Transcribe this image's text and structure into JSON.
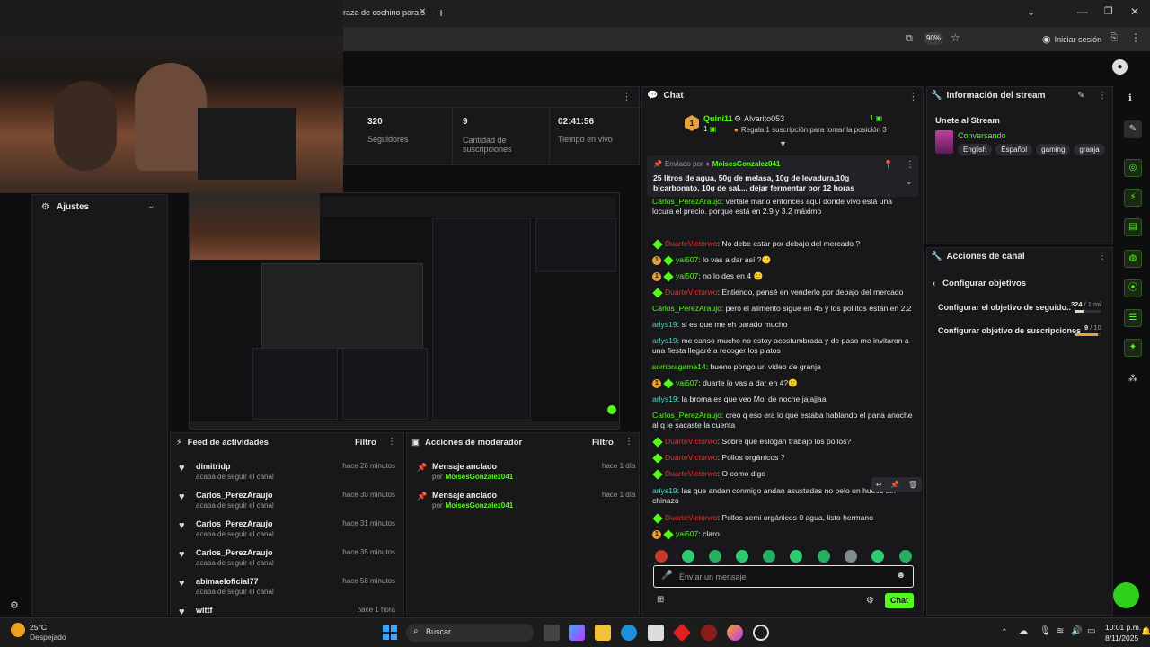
{
  "browser": {
    "tab_title": "raza de cochino para s",
    "zoom": "90%",
    "signin_label": "Iniciar sesión"
  },
  "stats": {
    "followers_value": "320",
    "followers_label": "Seguidores",
    "subs_value": "9",
    "subs_label_1": "Cantidad de",
    "subs_label_2": "suscripciones",
    "live_value": "02:41:56",
    "live_label": "Tiempo en vivo"
  },
  "settings_label": "Ajustes",
  "chat": {
    "title": "Chat",
    "top1_name": "Quini11",
    "top1_count": "1",
    "top2_name": "Alvarito053",
    "top2_count": "1",
    "gift_text": "Regala 1 suscripción para tomar la posición 3",
    "pinned_by_label": "Enviado por",
    "pinned_by_user": "MoisesGonzalez041",
    "pinned_text": "25 litros de agua, 50g de melasa, 10g de levadura,10g bicarbonato, 10g de sal.... dejar fermentar por 12 horas",
    "input_placeholder": "Enviar un mensaje",
    "send_label": "Chat",
    "messages": [
      {
        "user": "Carlos_PerezAraujo",
        "text": ": vertale mano entonces aquí donde vivo está una locura el precio. porque está en 2.9 y 3.2 máximo"
      },
      {
        "user": "DuarteVictorwo",
        "text": ": No debe estar por debajo del mercado ?"
      },
      {
        "user": "yai507",
        "text": ": lo vas a dar así ?🙂"
      },
      {
        "user": "yai507",
        "text": ": no lo des en 4 🙂"
      },
      {
        "user": "DuarteVictorwo",
        "text": ": Entiendo, pensé en venderlo por debajo del mercado"
      },
      {
        "user": "Carlos_PerezAraujo",
        "text": ": pero el alimento sigue en 45 y los pollitos están en 2.2"
      },
      {
        "user": "arlys19",
        "text": ": si es que me eh parado mucho"
      },
      {
        "user": "arlys19",
        "text": ": me canso mucho no estoy acostumbrada y de paso me invitaron a una fiesta llegaré a recoger los platos"
      },
      {
        "user": "sombragame14",
        "text": ": bueno pongo un video de granja"
      },
      {
        "user": "yai507",
        "text": ": duarte lo vas a dar en 4?🙂"
      },
      {
        "user": "arlys19",
        "text": ": la broma es que veo Moi de noche jajajjaa"
      },
      {
        "user": "Carlos_PerezAraujo",
        "text": ": creo q eso era lo que estaba hablando el pana anoche al q le sacaste la cuenta"
      },
      {
        "user": "DuarteVictorwo",
        "text": ": Sobre que eslogan trabajo los pollos?"
      },
      {
        "user": "DuarteVictorwo",
        "text": ": Pollos orgánicos ?"
      },
      {
        "user": "DuarteVictorwo",
        "text": ": O como digo"
      },
      {
        "user": "arlys19",
        "text": ": las que andan conmigo andan asustadas no pelo un hueco sin chinazo"
      },
      {
        "user": "DuarteVictorwo",
        "text": ": Pollos semi orgánicos 0 agua, listo hermano"
      },
      {
        "user": "yai507",
        "text": ": claro"
      }
    ]
  },
  "stream_info": {
    "title": "Información del stream",
    "stream_title": "Unete al Stream",
    "category": "Conversando",
    "tags": [
      "English",
      "Español",
      "gaming",
      "granja"
    ]
  },
  "channel_actions": {
    "title": "Acciones de canal",
    "back_label": "Configurar objetivos",
    "goal1_label": "Configurar el objetivo de seguido...",
    "goal1_current": "324",
    "goal1_target": " / 1 mil",
    "goal1_progress": 0.32,
    "goal2_label": "Configurar objetivo de suscripciones",
    "goal2_current": "9",
    "goal2_target": " / 10",
    "goal2_progress": 0.9
  },
  "activity_feed": {
    "title": "Feed de actividades",
    "filter_label": "Filtro",
    "items": [
      {
        "name": "dimitridp",
        "sub": "acaba de seguir el canal",
        "time": "hace 26 minutos"
      },
      {
        "name": "Carlos_PerezAraujo",
        "sub": "acaba de seguir el canal",
        "time": "hace 30 minutos"
      },
      {
        "name": "Carlos_PerezAraujo",
        "sub": "acaba de seguir el canal",
        "time": "hace 31 minutos"
      },
      {
        "name": "Carlos_PerezAraujo",
        "sub": "acaba de seguir el canal",
        "time": "hace 35 minutos"
      },
      {
        "name": "abimaeloficial77",
        "sub": "acaba de seguir el canal",
        "time": "hace 58 minutos"
      },
      {
        "name": "wittf",
        "sub": "",
        "time": "hace 1 hora"
      }
    ]
  },
  "mod_actions": {
    "title": "Acciones de moderador",
    "filter_label": "Filtro",
    "items": [
      {
        "title": "Mensaje anclado",
        "by": "por",
        "user": "MoisesGonzalez041",
        "time": "hace 1 día"
      },
      {
        "title": "Mensaje anclado",
        "by": "por",
        "user": "MoisesGonzalez041",
        "time": "hace 1 día"
      }
    ]
  },
  "taskbar": {
    "weather_temp": "25°C",
    "weather_desc": "Despejado",
    "search_label": "Buscar",
    "time": "10:01 p.m.",
    "date": "8/11/2025"
  },
  "colors": {
    "accent": "#53fc18",
    "mod_red": "#e0322e",
    "panel_bg": "#18181b",
    "page_bg": "#0e0e10"
  }
}
